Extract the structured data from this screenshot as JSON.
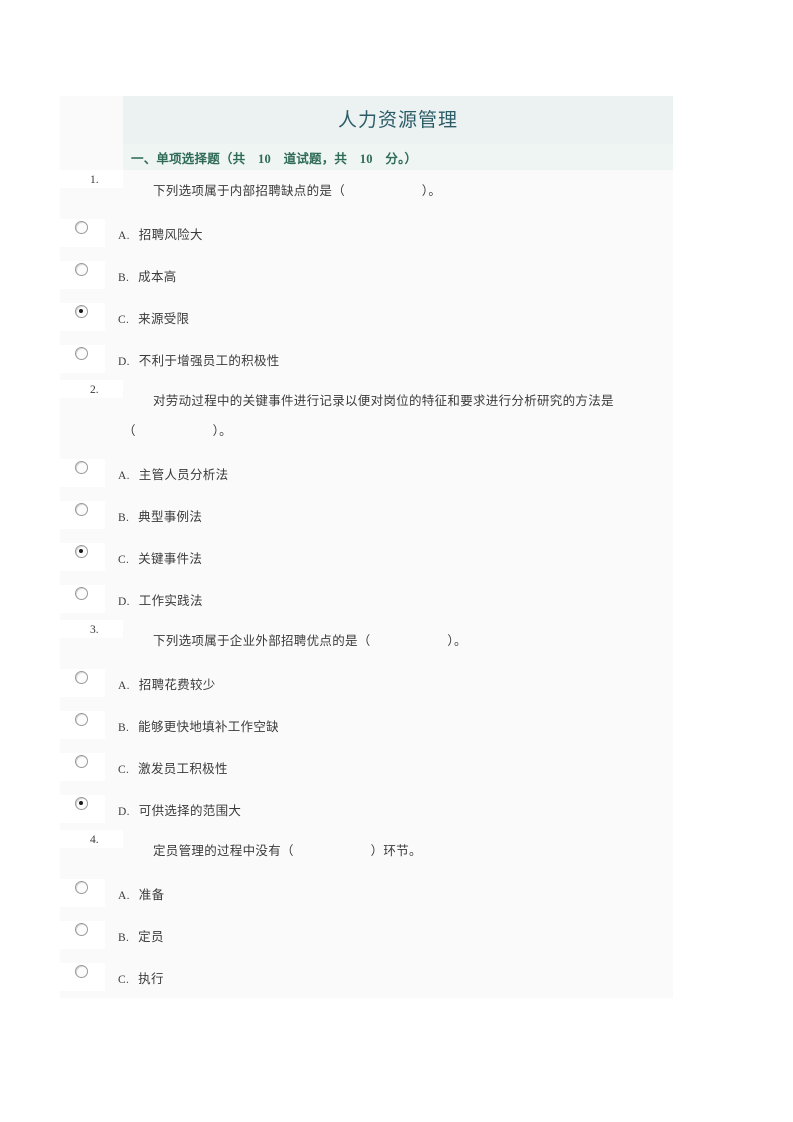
{
  "document": {
    "title": "人力资源管理",
    "section_header": "一、单项选择题（共　10　道试题，共　10　分。）",
    "accent_color": "#2f6b57",
    "title_color": "#2c5c68",
    "banner_color": "#ecf2f1",
    "strip_color": "#eef5f3",
    "sheet_color": "#fafafa"
  },
  "questions": [
    {
      "number": "1.",
      "text": "下列选项属于内部招聘缺点的是（　　　　　　）。",
      "text_line2": "",
      "options": [
        {
          "letter": "A.",
          "label": "招聘风险大",
          "checked": false
        },
        {
          "letter": "B.",
          "label": "成本高",
          "checked": false
        },
        {
          "letter": "C.",
          "label": "来源受限",
          "checked": true
        },
        {
          "letter": "D.",
          "label": "不利于增强员工的积极性",
          "checked": false
        }
      ]
    },
    {
      "number": "2.",
      "text": "对劳动过程中的关键事件进行记录以便对岗位的特征和要求进行分析研究的方法是",
      "text_line2": "（　　　　　　）。",
      "options": [
        {
          "letter": "A.",
          "label": "主管人员分析法",
          "checked": false
        },
        {
          "letter": "B.",
          "label": "典型事例法",
          "checked": false
        },
        {
          "letter": "C.",
          "label": "关键事件法",
          "checked": true
        },
        {
          "letter": "D.",
          "label": "工作实践法",
          "checked": false
        }
      ]
    },
    {
      "number": "3.",
      "text": "下列选项属于企业外部招聘优点的是（　　　　　　）。",
      "text_line2": "",
      "options": [
        {
          "letter": "A.",
          "label": "招聘花费较少",
          "checked": false
        },
        {
          "letter": "B.",
          "label": "能够更快地填补工作空缺",
          "checked": false
        },
        {
          "letter": "C.",
          "label": "激发员工积极性",
          "checked": false
        },
        {
          "letter": "D.",
          "label": "可供选择的范围大",
          "checked": true
        }
      ]
    },
    {
      "number": "4.",
      "text": "定员管理的过程中没有（　　　　　　）环节。",
      "text_line2": "",
      "options": [
        {
          "letter": "A.",
          "label": "准备",
          "checked": false
        },
        {
          "letter": "B.",
          "label": "定员",
          "checked": false
        },
        {
          "letter": "C.",
          "label": "执行",
          "checked": false
        }
      ]
    }
  ]
}
